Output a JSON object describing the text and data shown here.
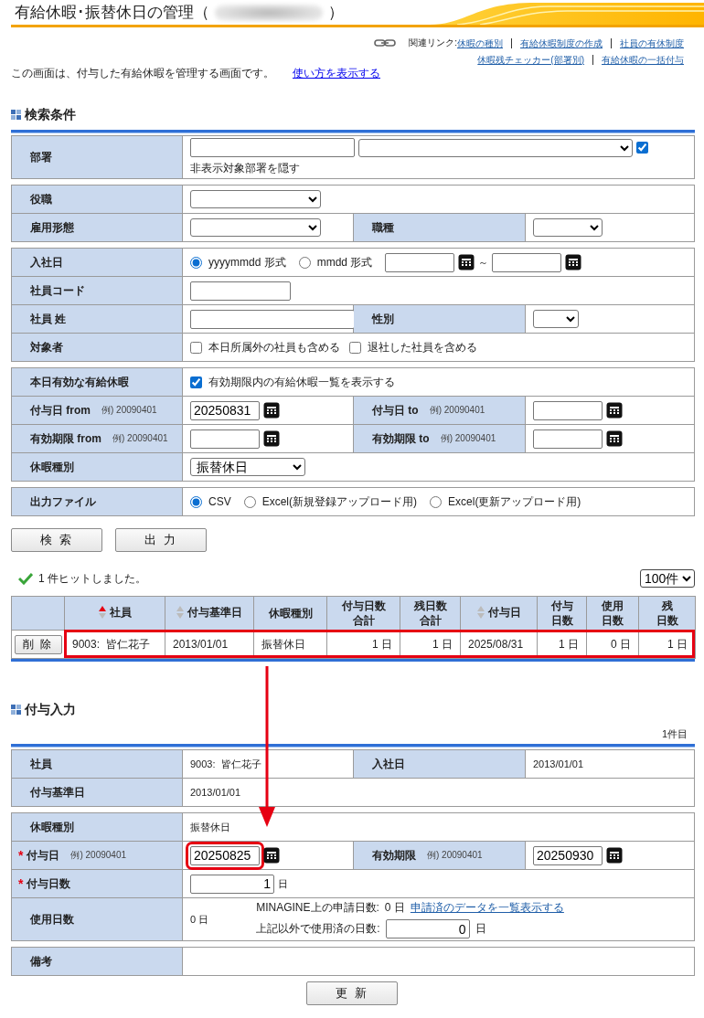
{
  "title": {
    "text": "有給休暇･振替休日の管理（",
    "close": "）"
  },
  "related_links": {
    "label": "関連リンク:",
    "lines": [
      [
        "休暇の種別",
        "有給休暇制度の作成",
        "社員の有休制度"
      ],
      [
        "休暇残チェッカー(部署別)",
        "有給休暇の一括付与"
      ]
    ]
  },
  "intro": {
    "text": "この画面は、付与した有給休暇を管理する画面です。",
    "link": "使い方を表示する"
  },
  "search": {
    "heading": "検索条件",
    "sections": [
      {
        "rows": [
          {
            "cells": [
              {
                "kind": "label",
                "text": "部署"
              },
              {
                "kind": "value",
                "items": [
                  {
                    "kind": "input"
                  },
                  {
                    "kind": "select"
                  },
                  {
                    "kind": "checkbox",
                    "label": "非表示対象部署を隠す",
                    "checked": true
                  }
                ]
              }
            ]
          }
        ]
      },
      {
        "rows": [
          {
            "cells": [
              {
                "kind": "label",
                "text": "役職"
              },
              {
                "kind": "value",
                "items": [
                  {
                    "kind": "select"
                  }
                ]
              }
            ]
          },
          {
            "cells": [
              {
                "kind": "label",
                "text": "雇用形態"
              },
              {
                "kind": "value",
                "items": [
                  {
                    "kind": "select"
                  }
                ]
              },
              {
                "kind": "label",
                "text": "職種"
              },
              {
                "kind": "value",
                "items": [
                  {
                    "kind": "select"
                  }
                ]
              }
            ]
          }
        ]
      },
      {
        "rows": [
          {
            "cells": [
              {
                "kind": "label",
                "text": "入社日"
              },
              {
                "kind": "value",
                "items": [
                  {
                    "kind": "radio",
                    "label": "yyyymmdd 形式",
                    "selected": true
                  },
                  {
                    "kind": "radio",
                    "label": "mmdd 形式",
                    "selected": false
                  },
                  {
                    "kind": "input"
                  },
                  {
                    "kind": "calendar"
                  },
                  {
                    "kind": "text",
                    "text": "～"
                  },
                  {
                    "kind": "input"
                  },
                  {
                    "kind": "calendar"
                  }
                ]
              }
            ]
          },
          {
            "cells": [
              {
                "kind": "label",
                "text": "社員コード"
              },
              {
                "kind": "value",
                "items": [
                  {
                    "kind": "input"
                  }
                ]
              }
            ]
          },
          {
            "cells": [
              {
                "kind": "label",
                "text": "社員 姓"
              },
              {
                "kind": "value",
                "items": [
                  {
                    "kind": "input"
                  }
                ]
              },
              {
                "kind": "label",
                "text": "性別"
              },
              {
                "kind": "value",
                "items": [
                  {
                    "kind": "select"
                  }
                ]
              }
            ]
          },
          {
            "cells": [
              {
                "kind": "label",
                "text": "対象者"
              },
              {
                "kind": "value",
                "items": [
                  {
                    "kind": "checkbox",
                    "label": "本日所属外の社員も含める",
                    "checked": false
                  },
                  {
                    "kind": "checkbox",
                    "label": "退社した社員を含める",
                    "checked": false
                  }
                ]
              }
            ]
          }
        ]
      },
      {
        "rows": [
          {
            "cells": [
              {
                "kind": "label",
                "text": "本日有効な有給休暇"
              },
              {
                "kind": "value",
                "items": [
                  {
                    "kind": "checkbox",
                    "label": "有効期限内の有給休暇一覧を表示する",
                    "checked": true
                  }
                ]
              }
            ]
          },
          {
            "cells": [
              {
                "kind": "label",
                "text": "付与日 from",
                "hint": "例) 20090401"
              },
              {
                "kind": "value",
                "items": [
                  {
                    "kind": "input",
                    "value": "20250831"
                  },
                  {
                    "kind": "calendar"
                  }
                ]
              },
              {
                "kind": "label",
                "text": "付与日 to",
                "hint": "例) 20090401"
              },
              {
                "kind": "value",
                "items": [
                  {
                    "kind": "input"
                  },
                  {
                    "kind": "calendar"
                  }
                ]
              }
            ]
          },
          {
            "cells": [
              {
                "kind": "label",
                "text": "有効期限 from",
                "hint": "例) 20090401"
              },
              {
                "kind": "value",
                "items": [
                  {
                    "kind": "input"
                  },
                  {
                    "kind": "calendar"
                  }
                ]
              },
              {
                "kind": "label",
                "text": "有効期限 to",
                "hint": "例) 20090401"
              },
              {
                "kind": "value",
                "items": [
                  {
                    "kind": "input"
                  },
                  {
                    "kind": "calendar"
                  }
                ]
              }
            ]
          },
          {
            "cells": [
              {
                "kind": "label",
                "text": "休暇種別"
              },
              {
                "kind": "value",
                "items": [
                  {
                    "kind": "select",
                    "value": "振替休日"
                  }
                ]
              }
            ]
          }
        ]
      },
      {
        "rows": [
          {
            "cells": [
              {
                "kind": "label",
                "text": "出力ファイル"
              },
              {
                "kind": "value",
                "items": [
                  {
                    "kind": "radio",
                    "label": "CSV",
                    "selected": true
                  },
                  {
                    "kind": "radio",
                    "label": "Excel(新規登録アップロード用)",
                    "selected": false
                  },
                  {
                    "kind": "radio",
                    "label": "Excel(更新アップロード用)",
                    "selected": false
                  }
                ]
              }
            ]
          }
        ]
      }
    ],
    "buttons": [
      "検 索",
      "出 力"
    ]
  },
  "results": {
    "message": "1 件ヒットしました。",
    "per_page": "100件",
    "columns": [
      {
        "lines": [
          "社員"
        ],
        "sortable": true,
        "sorted_ascending": true
      },
      {
        "lines": [
          "付与基準日"
        ],
        "sortable": true,
        "sorted_ascending": false
      },
      {
        "lines": [
          "休暇種別"
        ],
        "sortable": false
      },
      {
        "lines": [
          "付与日数",
          "合計"
        ],
        "sortable": false
      },
      {
        "lines": [
          "残日数",
          "合計"
        ],
        "sortable": false
      },
      {
        "lines": [
          "付与日"
        ],
        "sortable": true,
        "sorted_ascending": false
      },
      {
        "lines": [
          "付与",
          "日数"
        ],
        "sortable": false
      },
      {
        "lines": [
          "使用",
          "日数"
        ],
        "sortable": false
      },
      {
        "lines": [
          "残",
          "日数"
        ],
        "sortable": false
      }
    ],
    "rows": [
      {
        "button": "削 除",
        "highlighted": true,
        "cells": [
          "9003:  皆仁花子",
          "2013/01/01",
          "振替休日",
          "1 日",
          "1 日",
          "2025/08/31",
          "1 日",
          "0 日",
          "1 日"
        ]
      }
    ]
  },
  "grant": {
    "heading": "付与入力",
    "count": "1件目",
    "sections": [
      {
        "rows": [
          {
            "cells": [
              {
                "kind": "label",
                "text": "社員"
              },
              {
                "kind": "value",
                "items": [
                  {
                    "kind": "text",
                    "text": "9003:  皆仁花子"
                  }
                ]
              },
              {
                "kind": "label",
                "text": "入社日"
              },
              {
                "kind": "value",
                "items": [
                  {
                    "kind": "text",
                    "text": "2013/01/01"
                  }
                ]
              }
            ]
          },
          {
            "cells": [
              {
                "kind": "label",
                "text": "付与基準日"
              },
              {
                "kind": "value",
                "items": [
                  {
                    "kind": "text",
                    "text": "2013/01/01"
                  }
                ]
              }
            ]
          }
        ]
      },
      {
        "rows": [
          {
            "cells": [
              {
                "kind": "label",
                "text": "休暇種別"
              },
              {
                "kind": "value",
                "items": [
                  {
                    "kind": "text",
                    "text": "振替休日"
                  }
                ]
              }
            ]
          },
          {
            "cells": [
              {
                "kind": "label",
                "text": "付与日",
                "hint": "例) 20090401",
                "required_mark": "*"
              },
              {
                "kind": "value",
                "items": [
                  {
                    "kind": "input",
                    "value": "20250825",
                    "highlighted": true
                  },
                  {
                    "kind": "calendar"
                  }
                ]
              },
              {
                "kind": "label",
                "text": "有効期限",
                "hint": "例) 20090401"
              },
              {
                "kind": "value",
                "items": [
                  {
                    "kind": "input",
                    "value": "20250930",
                    "highlighted": false
                  },
                  {
                    "kind": "calendar"
                  }
                ]
              }
            ]
          },
          {
            "cells": [
              {
                "kind": "label",
                "text": "付与日数",
                "required_mark": "*"
              },
              {
                "kind": "value",
                "items": [
                  {
                    "kind": "input",
                    "value": "1"
                  },
                  {
                    "kind": "text",
                    "text": "日"
                  }
                ]
              }
            ]
          },
          {
            "cells": [
              {
                "kind": "label",
                "text": "使用日数"
              },
              {
                "kind": "value",
                "items": [
                  {
                    "kind": "text",
                    "text": "0 日"
                  },
                  {
                    "kind": "stack",
                    "lines": [
                      [
                        {
                          "kind": "text",
                          "text": "MINAGINE上の申請日数:"
                        },
                        {
                          "kind": "text",
                          "text": "0 日"
                        },
                        {
                          "kind": "link",
                          "text": "申請済のデータを一覧表示する"
                        }
                      ],
                      [
                        {
                          "kind": "text",
                          "text": "上記以外で使用済の日数:"
                        },
                        {
                          "kind": "input",
                          "value": "0"
                        },
                        {
                          "kind": "text",
                          "text": "日"
                        }
                      ]
                    ]
                  }
                ]
              }
            ]
          }
        ]
      },
      {
        "rows": [
          {
            "cells": [
              {
                "kind": "label",
                "text": "備考"
              },
              {
                "kind": "value"
              }
            ]
          }
        ]
      }
    ],
    "buttons": [
      "更 新"
    ]
  }
}
